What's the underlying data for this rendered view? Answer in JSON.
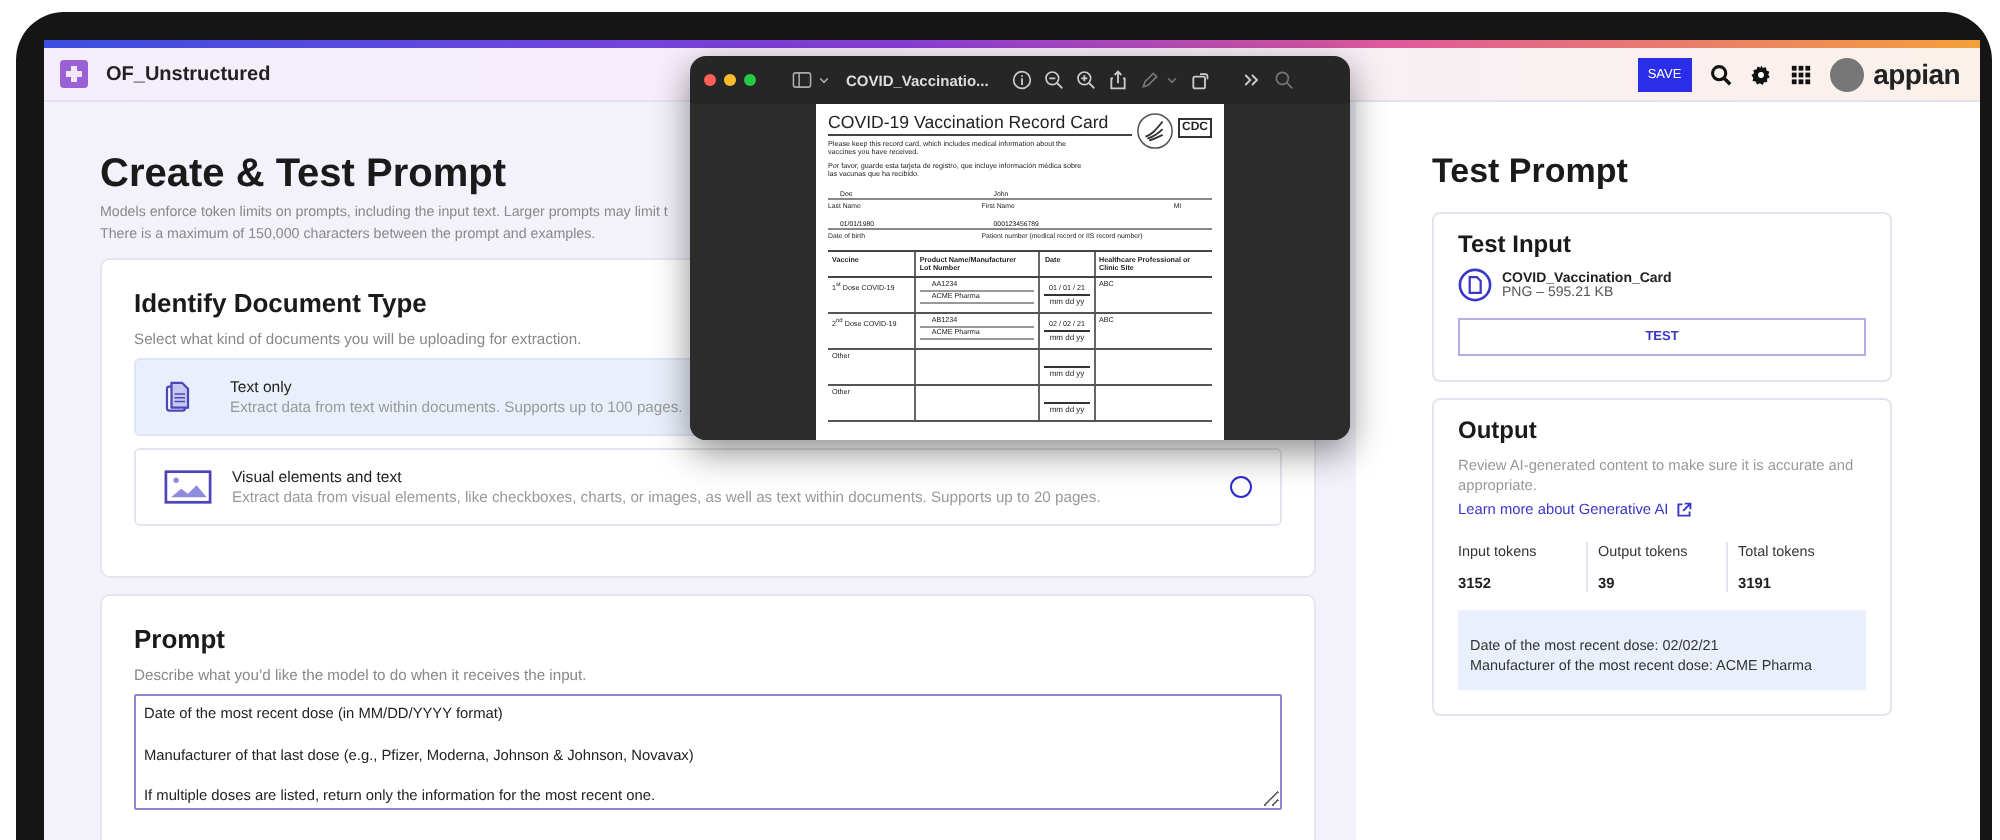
{
  "app_header": {
    "app_name": "OF_Unstructured",
    "save_button": "SAVE",
    "logo": "appian"
  },
  "main": {
    "title": "Create & Test Prompt",
    "description": [
      "Models enforce token limits on prompts, including the input text. Larger prompts may limit t",
      "There is a maximum of 150,000 characters between the prompt and examples."
    ],
    "document_type": {
      "title": "Identify Document Type",
      "subtitle": "Select what kind of documents you will be uploading for extraction.",
      "options": [
        {
          "kind": "document",
          "title": "Text only",
          "description": "Extract data from text within documents. Supports up to 100 pages.",
          "selected": true
        },
        {
          "kind": "image",
          "title": "Visual elements and text",
          "description": "Extract data from visual elements, like checkboxes, charts, or images, as well as text within documents. Supports up to 20 pages.",
          "selected": false
        }
      ]
    },
    "prompt": {
      "title": "Prompt",
      "subtitle": "Describe what you’d like the model to do when it receives the input.",
      "value": "Date of the most recent dose (in MM/DD/YYYY format)\n\nManufacturer of that last dose (e.g., Pfizer, Moderna, Johnson & Johnson, Novavax)\n\nIf multiple doses are listed, return only the information for the most recent one."
    }
  },
  "test_panel": {
    "title": "Test Prompt",
    "test_input": {
      "title": "Test Input",
      "file_name": "COVID_Vaccination_Card",
      "file_info": "PNG – 595.21 KB",
      "button": "TEST"
    },
    "output": {
      "title": "Output",
      "description": "Review AI-generated content to make sure it is accurate and appropriate.",
      "link": "Learn more about Generative AI",
      "tokens": [
        {
          "label": "Input tokens",
          "value": "3152"
        },
        {
          "label": "Output tokens",
          "value": "39"
        },
        {
          "label": "Total tokens",
          "value": "3191"
        }
      ],
      "result": [
        "Date of the most recent dose: 02/02/21",
        "Manufacturer of the most recent dose: ACME Pharma"
      ]
    }
  },
  "preview_window": {
    "traffic_lights": [
      {
        "color": "#ff5f57"
      },
      {
        "color": "#febc2e"
      },
      {
        "color": "#28c840"
      }
    ],
    "title": "COVID_Vaccinatio...",
    "document": {
      "title": "COVID-19 Vaccination Record Card",
      "note_en": "Please keep this record card, which includes medical information about the vaccines you have received.",
      "note_es": "Por favor, guarde esta tarjeta de registro, que incluye información médica sobre las vacunas que ha recibido.",
      "logo": "CDC",
      "fields": [
        [
          {
            "value": "Doe",
            "label": "Last Name"
          },
          {
            "value": "John",
            "label": "First Name"
          },
          {
            "label": "MI"
          }
        ],
        [
          {
            "value": "01/01/1980",
            "label": "Date of birth"
          },
          {
            "value": "000123456789",
            "label": "Patient number (medical record or IIS record number)"
          }
        ]
      ],
      "columns": [
        [
          "Vaccine"
        ],
        [
          "Product Name/Manufacturer",
          "Lot Number"
        ],
        [
          "Date"
        ],
        [
          "Healthcare Professional or",
          "Clinic Site"
        ]
      ],
      "rows": [
        {
          "vaccine": "1$^{st}$ Dose COVID-19",
          "product": [
            "AA1234",
            "ACME Pharma"
          ],
          "date": "01 / 01 / 21",
          "date_hint": "mm  dd  yy",
          "site": "ABC"
        },
        {
          "vaccine": "2$^{nd}$ Dose COVID-19",
          "product": [
            "AB1234",
            "ACME Pharma"
          ],
          "date": "02 / 02 / 21",
          "date_hint": "mm  dd  yy",
          "site": "ABC"
        },
        {
          "vaccine": "Other",
          "date_hint": "mm  dd  yy"
        },
        {
          "vaccine": "Other",
          "date_hint": "mm  dd  yy"
        }
      ]
    }
  }
}
